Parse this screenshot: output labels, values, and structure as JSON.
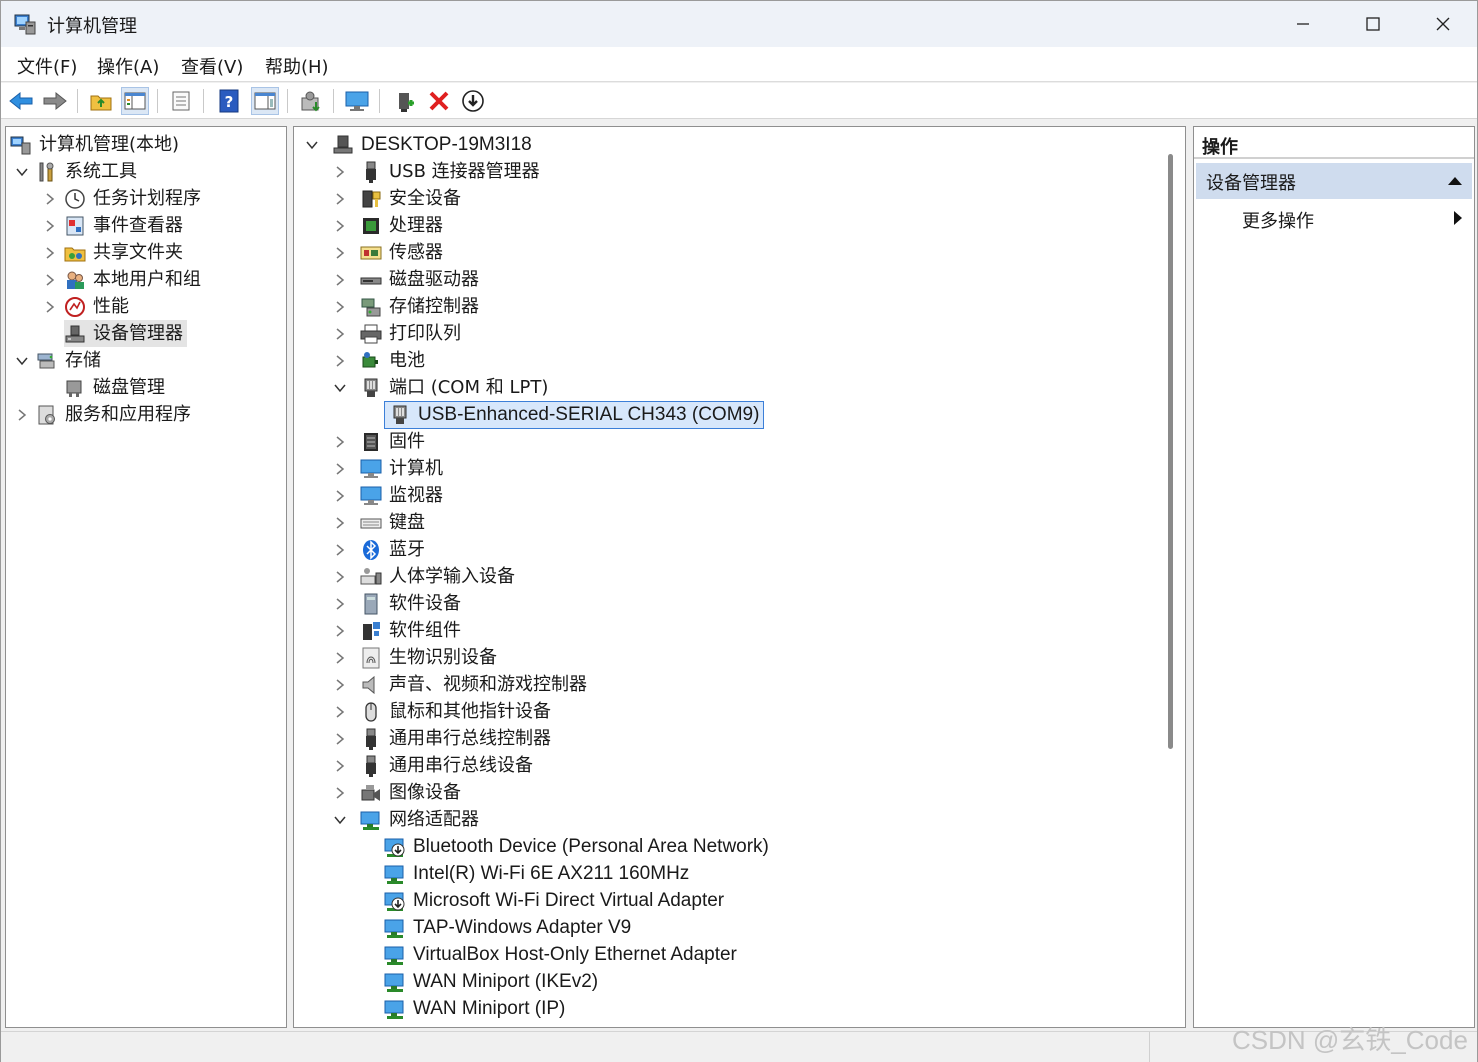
{
  "window": {
    "title": "计算机管理",
    "minimize_glyph": "—",
    "maximize_glyph": "☐",
    "close_glyph": "✕"
  },
  "menu": [
    "文件(F)",
    "操作(A)",
    "查看(V)",
    "帮助(H)"
  ],
  "left_tree": [
    {
      "label": "计算机管理(本地)",
      "icon": "computer-management-icon",
      "level": 0,
      "chevron": "none"
    },
    {
      "label": "系统工具",
      "icon": "tools-icon",
      "level": 1,
      "chevron": "expanded"
    },
    {
      "label": "任务计划程序",
      "icon": "clock-icon",
      "level": 2,
      "chevron": "collapsed"
    },
    {
      "label": "事件查看器",
      "icon": "event-viewer-icon",
      "level": 2,
      "chevron": "collapsed"
    },
    {
      "label": "共享文件夹",
      "icon": "shared-folder-icon",
      "level": 2,
      "chevron": "collapsed"
    },
    {
      "label": "本地用户和组",
      "icon": "users-icon",
      "level": 2,
      "chevron": "collapsed"
    },
    {
      "label": "性能",
      "icon": "performance-icon",
      "level": 2,
      "chevron": "collapsed"
    },
    {
      "label": "设备管理器",
      "icon": "device-manager-icon",
      "level": 2,
      "chevron": "none",
      "selected": true
    },
    {
      "label": "存储",
      "icon": "storage-icon",
      "level": 1,
      "chevron": "expanded"
    },
    {
      "label": "磁盘管理",
      "icon": "disk-management-icon",
      "level": 2,
      "chevron": "none"
    },
    {
      "label": "服务和应用程序",
      "icon": "services-icon",
      "level": 1,
      "chevron": "collapsed"
    }
  ],
  "device_tree": {
    "root": "DESKTOP-19M3I18",
    "categories": [
      {
        "label": "USB 连接器管理器",
        "icon": "usb-connector-icon",
        "expanded": false
      },
      {
        "label": "安全设备",
        "icon": "security-device-icon",
        "expanded": false
      },
      {
        "label": "处理器",
        "icon": "processor-icon",
        "expanded": false
      },
      {
        "label": "传感器",
        "icon": "sensor-icon",
        "expanded": false
      },
      {
        "label": "磁盘驱动器",
        "icon": "disk-drive-icon",
        "expanded": false
      },
      {
        "label": "存储控制器",
        "icon": "storage-controller-icon",
        "expanded": false
      },
      {
        "label": "打印队列",
        "icon": "printer-icon",
        "expanded": false
      },
      {
        "label": "电池",
        "icon": "battery-icon",
        "expanded": false
      },
      {
        "label": "端口 (COM 和 LPT)",
        "icon": "port-icon",
        "expanded": true,
        "children": [
          {
            "label": "USB-Enhanced-SERIAL CH343 (COM9)",
            "icon": "serial-port-icon",
            "focused": true
          }
        ]
      },
      {
        "label": "固件",
        "icon": "firmware-icon",
        "expanded": false
      },
      {
        "label": "计算机",
        "icon": "computer-icon",
        "expanded": false
      },
      {
        "label": "监视器",
        "icon": "monitor-icon",
        "expanded": false
      },
      {
        "label": "键盘",
        "icon": "keyboard-icon",
        "expanded": false
      },
      {
        "label": "蓝牙",
        "icon": "bluetooth-icon",
        "expanded": false
      },
      {
        "label": "人体学输入设备",
        "icon": "hid-icon",
        "expanded": false
      },
      {
        "label": "软件设备",
        "icon": "software-device-icon",
        "expanded": false
      },
      {
        "label": "软件组件",
        "icon": "software-component-icon",
        "expanded": false
      },
      {
        "label": "生物识别设备",
        "icon": "biometric-icon",
        "expanded": false
      },
      {
        "label": "声音、视频和游戏控制器",
        "icon": "sound-icon",
        "expanded": false
      },
      {
        "label": "鼠标和其他指针设备",
        "icon": "mouse-icon",
        "expanded": false
      },
      {
        "label": "通用串行总线控制器",
        "icon": "usb-controller-icon",
        "expanded": false
      },
      {
        "label": "通用串行总线设备",
        "icon": "usb-device-icon",
        "expanded": false
      },
      {
        "label": "图像设备",
        "icon": "camera-icon",
        "expanded": false
      },
      {
        "label": "网络适配器",
        "icon": "network-adapter-icon",
        "expanded": true,
        "children": [
          {
            "label": "Bluetooth Device (Personal Area Network)",
            "icon": "network-adapter-disabled-icon"
          },
          {
            "label": "Intel(R) Wi-Fi 6E AX211 160MHz",
            "icon": "network-adapter-icon"
          },
          {
            "label": "Microsoft Wi-Fi Direct Virtual Adapter",
            "icon": "network-adapter-disabled-icon"
          },
          {
            "label": "TAP-Windows Adapter V9",
            "icon": "network-adapter-icon"
          },
          {
            "label": "VirtualBox Host-Only Ethernet Adapter",
            "icon": "network-adapter-icon"
          },
          {
            "label": "WAN Miniport (IKEv2)",
            "icon": "network-adapter-icon"
          },
          {
            "label": "WAN Miniport (IP)",
            "icon": "network-adapter-icon"
          }
        ]
      }
    ]
  },
  "actions": {
    "header": "操作",
    "section": "设备管理器",
    "more": "更多操作"
  },
  "watermark": "CSDN @玄铁_Code",
  "colors": {
    "selection_bg": "#cfdcee",
    "focus_border": "#3c7fd8",
    "focus_bg": "#d7e7fb",
    "monitor_blue": "#2f8fe0",
    "delete_red": "#e02020"
  }
}
